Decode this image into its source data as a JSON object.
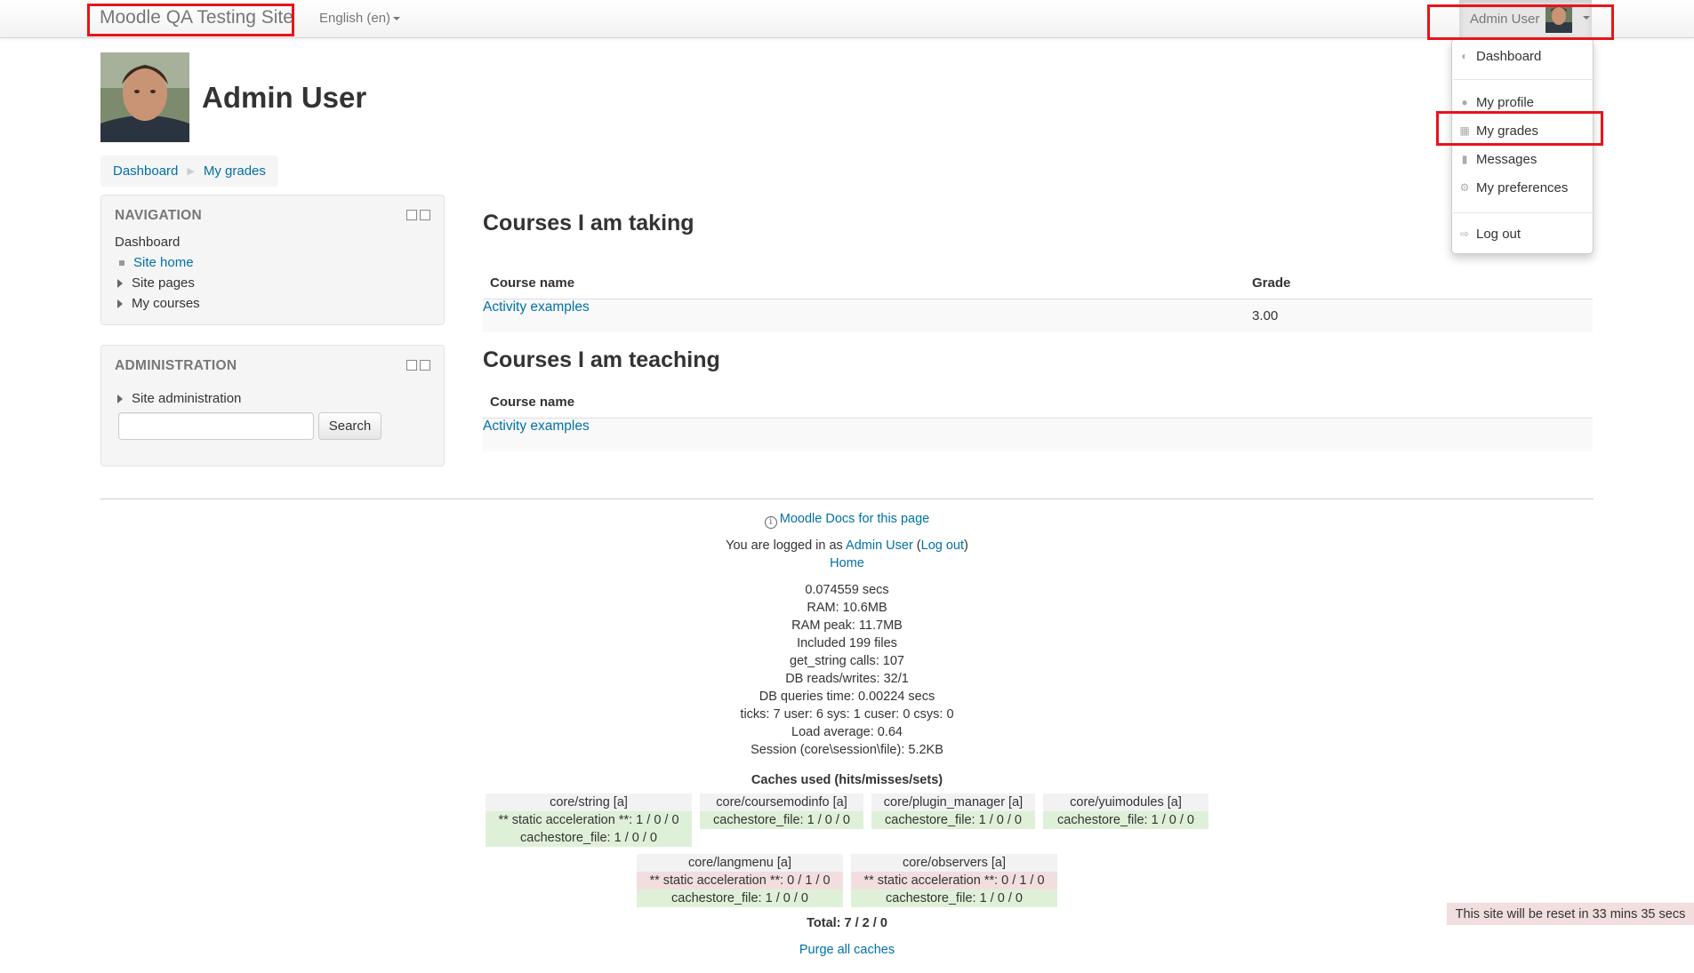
{
  "navbar": {
    "brand": "Moodle QA Testing Site",
    "language": "English (en)",
    "user_name": "Admin User"
  },
  "user_menu": {
    "items": [
      {
        "label": "Dashboard",
        "icon": "dashboard-icon"
      },
      {
        "label": "My profile",
        "icon": "user-icon"
      },
      {
        "label": "My grades",
        "icon": "grades-icon"
      },
      {
        "label": "Messages",
        "icon": "messages-icon"
      },
      {
        "label": "My preferences",
        "icon": "gear-icon"
      },
      {
        "label": "Log out",
        "icon": "logout-icon"
      }
    ]
  },
  "page": {
    "heading": "Admin User"
  },
  "breadcrumb": [
    "Dashboard",
    "My grades"
  ],
  "navigation_block": {
    "title": "NAVIGATION",
    "root": "Dashboard",
    "items": [
      "Site home",
      "Site pages",
      "My courses"
    ]
  },
  "admin_block": {
    "title": "ADMINISTRATION",
    "items": [
      "Site administration"
    ],
    "search_button": "Search",
    "search_value": ""
  },
  "taking": {
    "heading": "Courses I am taking",
    "columns": [
      "Course name",
      "Grade"
    ],
    "rows": [
      [
        "Activity examples",
        "3.00"
      ]
    ]
  },
  "teaching": {
    "heading": "Courses I am teaching",
    "columns": [
      "Course name"
    ],
    "rows": [
      [
        "Activity examples"
      ]
    ]
  },
  "footer": {
    "docs_link": "Moodle Docs for this page",
    "logged_in_prefix": "You are logged in as",
    "logged_in_user": "Admin User",
    "logout": "Log out",
    "home": "Home",
    "perf": [
      "0.074559 secs",
      "RAM: 10.6MB",
      "RAM peak: 11.7MB",
      "Included 199 files",
      "get_string calls: 107",
      "DB reads/writes: 32/1",
      "DB queries time: 0.00224 secs",
      "ticks: 7 user: 6 sys: 1 cuser: 0 csys: 0",
      "Load average: 0.64",
      "Session (core\\session\\file): 5.2KB"
    ],
    "caches_title": "Caches used (hits/misses/sets)",
    "caches": [
      {
        "name": "core/string [a]",
        "lines": [
          [
            "** static acceleration **: 1 / 0 / 0",
            "ok"
          ],
          [
            "cachestore_file: 1 / 0 / 0",
            "ok"
          ]
        ]
      },
      {
        "name": "core/coursemodinfo [a]",
        "lines": [
          [
            "cachestore_file: 1 / 0 / 0",
            "ok"
          ]
        ]
      },
      {
        "name": "core/plugin_manager [a]",
        "lines": [
          [
            "cachestore_file: 1 / 0 / 0",
            "ok"
          ]
        ]
      },
      {
        "name": "core/yuimodules [a]",
        "lines": [
          [
            "cachestore_file: 1 / 0 / 0",
            "ok"
          ]
        ]
      },
      {
        "name": "core/langmenu [a]",
        "lines": [
          [
            "** static acceleration **: 0 / 1 / 0",
            "bad"
          ],
          [
            "cachestore_file: 1 / 0 / 0",
            "ok"
          ]
        ]
      },
      {
        "name": "core/observers [a]",
        "lines": [
          [
            "** static acceleration **: 0 / 1 / 0",
            "bad"
          ],
          [
            "cachestore_file: 1 / 0 / 0",
            "ok"
          ]
        ]
      }
    ],
    "total": "Total: 7 / 2 / 0",
    "purge": "Purge all caches"
  },
  "reset_notice": "This site will be reset in 33 mins 35 secs",
  "colors": {
    "link": "#0070a8",
    "highlight": "#e8141b",
    "ok": "#dff0d8",
    "bad": "#f2dede"
  }
}
